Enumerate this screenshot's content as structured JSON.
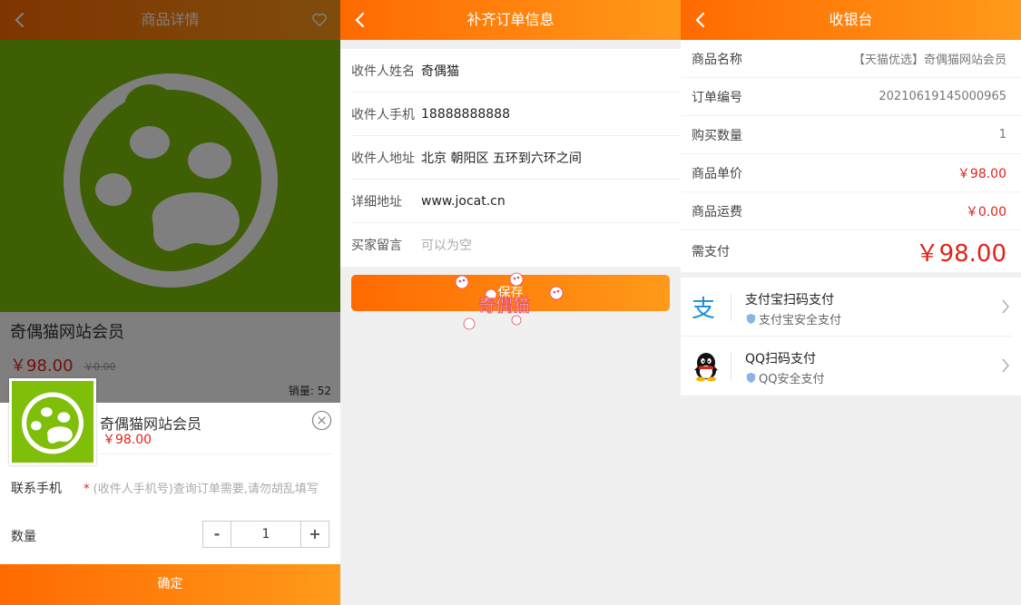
{
  "screen1": {
    "header_title": "商品详情",
    "product_name": "奇偶猫网站会员",
    "price": "￥98.00",
    "old_price": "￥0.00",
    "sales": "销量: 52",
    "sheet": {
      "name": "奇偶猫网站会员",
      "price": "￥98.00",
      "phone_label": "联系手机",
      "phone_required": "*",
      "phone_placeholder": "(收件人手机号)查询订单需要,请勿胡乱填写",
      "qty_label": "数量",
      "qty_minus": "-",
      "qty_value": "1",
      "qty_plus": "+"
    },
    "confirm_label": "确定"
  },
  "screen2": {
    "header_title": "补齐订单信息",
    "fields": [
      {
        "label": "收件人姓名",
        "value": "奇偶猫"
      },
      {
        "label": "收件人手机",
        "value": "18888888888"
      },
      {
        "label": "收件人地址",
        "value": "北京 朝阳区 五环到六环之间"
      },
      {
        "label": "详细地址",
        "value": "www.jocat.cn"
      },
      {
        "label": "买家留言",
        "placeholder": "可以为空"
      }
    ],
    "save_label": "保存",
    "loading_text": "奇偶猫"
  },
  "screen3": {
    "header_title": "收银台",
    "rows": [
      {
        "label": "商品名称",
        "value": "【天猫优选】奇偶猫网站会员"
      },
      {
        "label": "订单编号",
        "value": "20210619145000965"
      },
      {
        "label": "购买数量",
        "value": "1"
      },
      {
        "label": "商品单价",
        "value": "￥98.00"
      },
      {
        "label": "商品运费",
        "value": "￥0.00"
      },
      {
        "label": "需支付",
        "value": "￥98.00"
      }
    ],
    "payments": [
      {
        "title": "支付宝扫码支付",
        "subtitle": "支付宝安全支付",
        "icon": "alipay-icon"
      },
      {
        "title": "QQ扫码支付",
        "subtitle": "QQ安全支付",
        "icon": "qq-icon"
      }
    ]
  },
  "colors": {
    "accent_start": "#ff6a00",
    "accent_end": "#ff9a1a",
    "price_red": "#e2231a",
    "product_green": "#7fbf0a"
  }
}
